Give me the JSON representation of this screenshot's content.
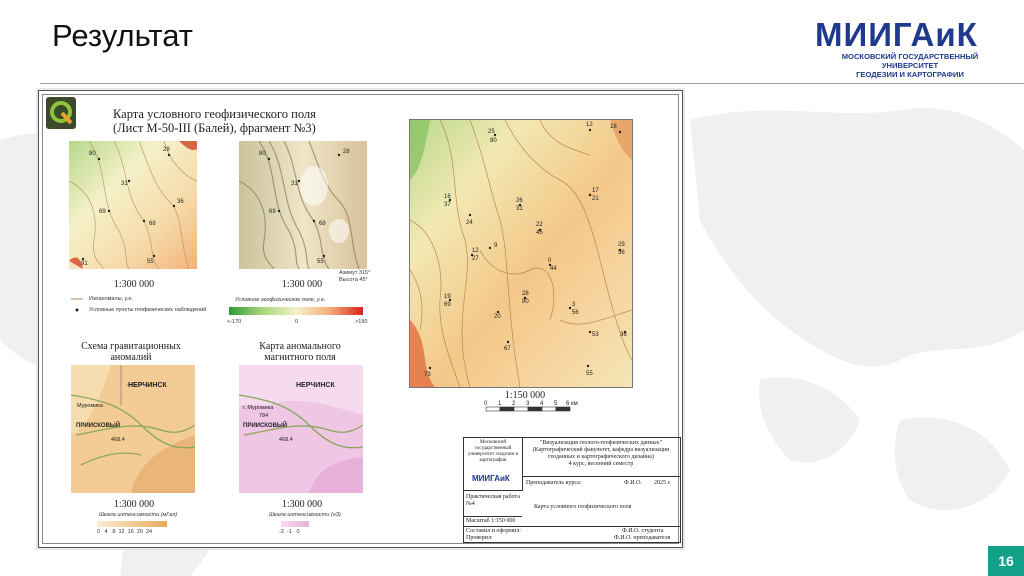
{
  "header": {
    "title": "Результат",
    "logo_word": "МИИГАиК",
    "logo_line1": "МОСКОВСКИЙ ГОСУДАРСТВЕННЫЙ УНИВЕРСИТЕТ",
    "logo_line2": "ГЕОДЕЗИИ И КАРТОГРАФИИ"
  },
  "page_number": "16",
  "poster": {
    "title_line1": "Карта условного геофизического поля",
    "title_line2": "(Лист M-50-III (Балей), фрагмент №3)",
    "scale_left": "1:300 000",
    "scale_right": "1:300 000",
    "azimuth": "Азимут 315°",
    "height": "Высота 45°",
    "legend_iso": "Изоаномалы, у.е.",
    "legend_points": "Условные пункты геофизических наблюдений",
    "field_title": "Условное геофизическое поле, у.е.",
    "field_min": "<-170",
    "field_mid": "0",
    "field_max": ">190",
    "grav_title": "Схема гравитационных аномалий",
    "mag_title": "Карта аномального магнитного поля",
    "grav_scale": "1:300 000",
    "mag_scale": "1:300 000",
    "grav_legend": "Шкала интенсивности (мГал)",
    "grav_ticks": [
      "0",
      "4",
      "8",
      "12",
      "16",
      "20",
      "24"
    ],
    "mag_legend": "Шкала интенсивности (нЗ)",
    "mag_ticks": [
      "-2",
      "-1",
      "0"
    ],
    "town": "НЕРЧИНСК",
    "place1": "Муромика",
    "place1b": "г. Муромика",
    "place2": "ПРИИСКОВЫЙ",
    "n784": "784",
    "n468": "468.4",
    "big_scale": "1:150 000",
    "big_ticks": [
      "0",
      "1",
      "2",
      "3",
      "4",
      "5",
      "6 км"
    ]
  },
  "stamp": {
    "uni": "Московский государственный университет геодезии и картографии",
    "course_title": "\"Визуализация геолого-геофизических данных\"",
    "course_sub": "(Картографический факультет, кафедра визуализации геоданных и картографического дизайна)",
    "course_sem": "4 курс, весенний семестр",
    "teacher_label": "Преподаватель курса:",
    "fio": "Ф.И.О.",
    "year": "2025 г.",
    "work": "Практическая работа №4",
    "map_name": "Карта условного геофизического поля",
    "scale": "Масштаб 1:150 000",
    "made": "Составил и оформил:",
    "checked": "Проверил:",
    "fio_student": "Ф.И.О. студента",
    "fio_teacher": "Ф.И.О. преподавателя"
  },
  "colors": {
    "accent": "#13a089",
    "brand": "#1f3a8c"
  }
}
